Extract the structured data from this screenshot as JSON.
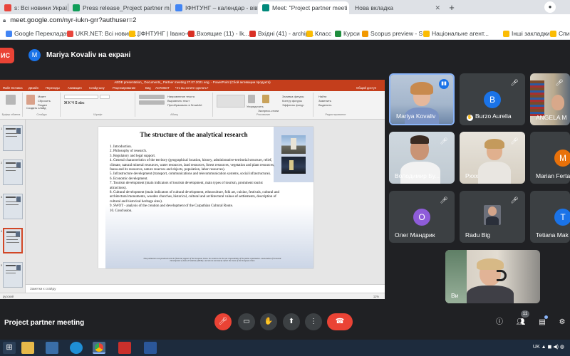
{
  "browser": {
    "tabs": [
      {
        "label": "ѕ: Всі новини України, о",
        "active": false,
        "color": "#e8453c"
      },
      {
        "label": "Press release_Project partner m",
        "active": false,
        "color": "#0f9d58"
      },
      {
        "label": "ІФНТУНГ – календар - вівторо",
        "active": false,
        "color": "#4285f4"
      },
      {
        "label": "Meet: \"Project partner meeti",
        "active": true,
        "color": "#00897b"
      },
      {
        "label": "Нова вкладка",
        "active": false,
        "color": "#9aa0a6"
      }
    ],
    "address": "meet.google.com/nyr-iukn-grr?authuser=2",
    "bookmarks": [
      {
        "label": "Google Перекладач",
        "color": "#4285f4"
      },
      {
        "label": "UKR.NET: Всі новини...",
        "color": "#e8453c"
      },
      {
        "label": "[ІФНТУНГ | Івано-Ф...",
        "color": "#fbbc04"
      },
      {
        "label": "Вхоящие (11) - Ik...",
        "color": "#d93025"
      },
      {
        "label": "Вхідні (41) - archip...",
        "color": "#d93025"
      },
      {
        "label": "Класс",
        "color": "#fbbc04"
      },
      {
        "label": "Курси",
        "color": "#1e8e3e"
      },
      {
        "label": "Scopus preview - S...",
        "color": "#f29900"
      },
      {
        "label": "Національне агент...",
        "color": "#fbbc04"
      },
      {
        "label": "Інші закладки",
        "color": "#fbbc04"
      },
      {
        "label": "Спис",
        "color": "#fbbc04"
      }
    ]
  },
  "meet": {
    "present_button": "ИС",
    "presenter_initial": "M",
    "presenter_label": "Mariya Kovaliv на екрані",
    "meeting_title": "Project partner meeting",
    "people_count": "11",
    "participants": [
      {
        "name": "Mariya Kovaliv",
        "type": "video",
        "speaking": true
      },
      {
        "name": "Burzo Aurelia",
        "type": "avatar",
        "initial": "B",
        "color": "#1a73e8",
        "pin_icon": true
      },
      {
        "name": "ANGELA M",
        "type": "video"
      },
      {
        "name": "Володимир Бу...",
        "type": "video"
      },
      {
        "name": "Pxxx",
        "type": "video"
      },
      {
        "name": "Marian Ferta",
        "type": "avatar",
        "initial": "M",
        "color": "#e8710a"
      },
      {
        "name": "Олег Мандрик",
        "type": "avatar",
        "initial": "O",
        "color": "#8e5cd9"
      },
      {
        "name": "Radu Big",
        "type": "video"
      },
      {
        "name": "Tetiana Mak",
        "type": "avatar",
        "initial": "T",
        "color": "#1a73e8"
      },
      {
        "name": "Ви",
        "type": "video"
      }
    ]
  },
  "ppt": {
    "window_title": "AEDE presentation_ Documents_ Partner meeting 27.07.2021 eng. - PowerPoint (Сбой активации продукта)",
    "ribbon_tabs": [
      "Файл",
      "Вставка",
      "Дизайн",
      "Переходы",
      "Анимация",
      "Слайд-шоу",
      "Рецензирование",
      "Вид",
      "ACROBAT",
      "Что вы хотите сделать?"
    ],
    "share_label": "Общий доступ",
    "ribbon_groups": [
      "Буфер обмена",
      "Слайды",
      "Шрифт",
      "Абзац",
      "Рисование",
      "Редактирование"
    ],
    "ribbon_items": [
      "Создать слайд",
      "Макет",
      "Сбросить",
      "Раздел",
      "Направление текста",
      "Выровнять текст",
      "Преобразовать в SmartArt",
      "Упорядочить",
      "Экспресс-стили",
      "Заливка фигуры",
      "Контур фигуры",
      "Эффекты фигур",
      "Найти",
      "Заменить",
      "Выделить"
    ],
    "thumb_numbers": [
      "1",
      "2",
      "3",
      "4",
      "5"
    ],
    "notes_label": "Заметки к слайду",
    "status_label": "русский",
    "zoom_label": "11%",
    "slide": {
      "title": "The structure of the analytical research",
      "items": [
        "1. Introduction.",
        "2. Philosophy of research.",
        "3. Regulatory and legal support.",
        "4. General characteristics of the territory (geographical location, history, administrative-territorial structure, relief, climate, natural mineral resources, water resources, land resources, forest resources, vegetation and plant resources, fauna and its resources, nature reserves and objects, population, labor resources).",
        "5. Infrastructure development (transport, communications and telecommunication systems, social infrastructure).",
        "6. Economic development.",
        "7. Tourism development (main indicators of tourism development, main types of tourism, prominent tourist attractions).",
        "8. Cultural development (main indicators of cultural development, ethnoculture, folk art, cuisine, festivals, cultural and architectural monuments, wooden churches, historical, cultural and architectural values of settlements, description of cultural and historical heritage sites).",
        "9. SWOT - analysis of the creation and development of the Carpathian Cultural Route.",
        "10. Conclusion."
      ],
      "footnote": "This publication was produced with the financial support of the European Union. Its contents are the sole responsibility of the public organization «Association of Economic Development of Ivano-Frankivsk (AEDE)» and do not necessarily reflect the views of the European Union"
    }
  },
  "system": {
    "tray": "UK  ▲ ◼ ◀) ◍"
  }
}
